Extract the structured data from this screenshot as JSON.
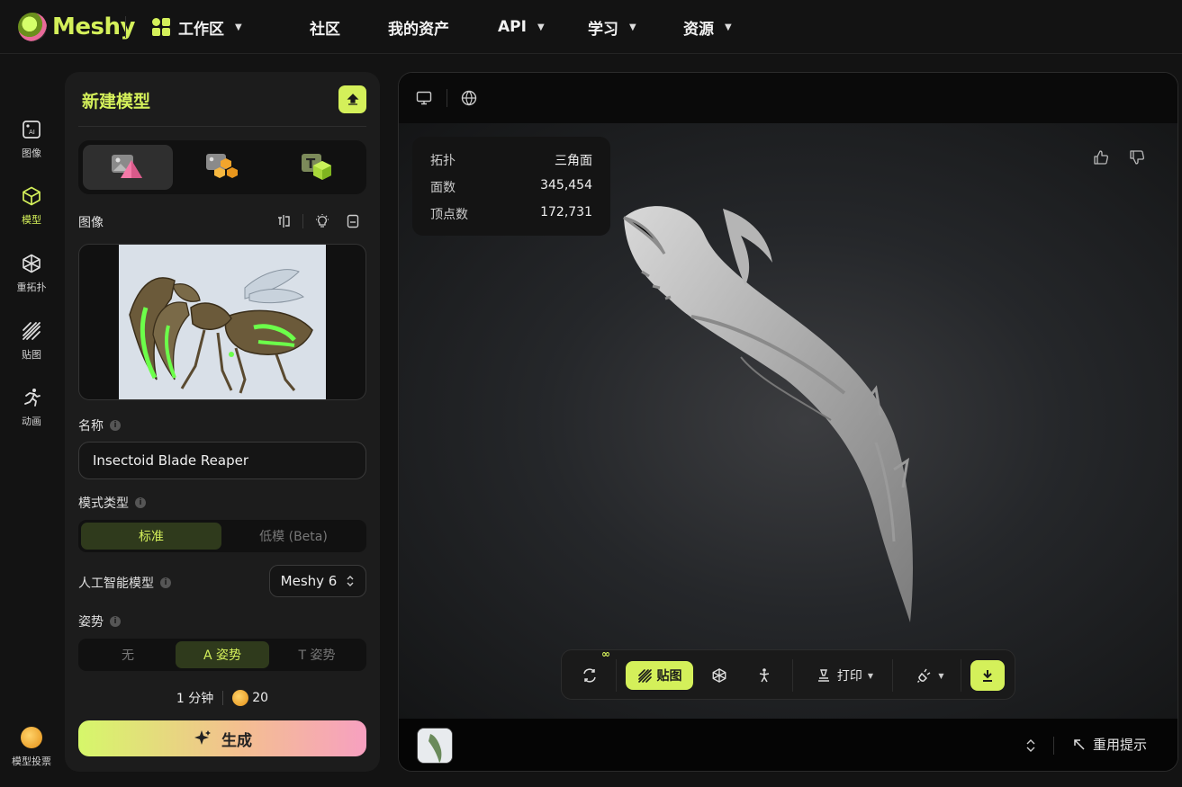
{
  "brand": {
    "name": "Meshy",
    "accent": "#d4f05a"
  },
  "nav": {
    "items": [
      {
        "label": "工作区",
        "has_caret": true
      },
      {
        "label": "社区",
        "has_caret": false
      },
      {
        "label": "我的资产",
        "has_caret": false
      },
      {
        "label": "API",
        "has_caret": true
      },
      {
        "label": "学习",
        "has_caret": true
      },
      {
        "label": "资源",
        "has_caret": true
      }
    ]
  },
  "rail": {
    "items": [
      {
        "label": "图像",
        "icon": "ai-image-icon",
        "active": false
      },
      {
        "label": "模型",
        "icon": "cube-icon",
        "active": true
      },
      {
        "label": "重拓扑",
        "icon": "retopo-icon",
        "active": false
      },
      {
        "label": "贴图",
        "icon": "texture-icon",
        "active": false
      },
      {
        "label": "动画",
        "icon": "running-icon",
        "active": false
      }
    ],
    "bottom": {
      "label": "模型投票",
      "icon": "vote-coin-icon"
    }
  },
  "panel": {
    "title": "新建模型",
    "mode_tabs": [
      {
        "name": "image-to-3d",
        "active": true
      },
      {
        "name": "multi-image-to-3d",
        "active": false
      },
      {
        "name": "text-to-3d",
        "active": false
      }
    ],
    "image_section": {
      "label": "图像"
    },
    "name_section": {
      "label": "名称",
      "value": "Insectoid Blade Reaper"
    },
    "mode_type": {
      "label": "模式类型",
      "options": [
        "标准",
        "低模 (Beta)"
      ],
      "selected": 0
    },
    "ai_model": {
      "label": "人工智能模型",
      "value": "Meshy 6"
    },
    "pose": {
      "label": "姿势",
      "options": [
        "无",
        "A 姿势",
        "T 姿势"
      ],
      "selected": 1
    },
    "cost": {
      "time": "1 分钟",
      "credits": "20"
    },
    "generate_label": "生成"
  },
  "viewer": {
    "stats": [
      {
        "label": "拓扑",
        "value": "三角面"
      },
      {
        "label": "面数",
        "value": "345,454"
      },
      {
        "label": "顶点数",
        "value": "172,731"
      }
    ],
    "toolbar": {
      "infinity_badge": "∞",
      "texture_label": "贴图",
      "print_label": "打印"
    },
    "reuse_prompt_label": "重用提示"
  }
}
